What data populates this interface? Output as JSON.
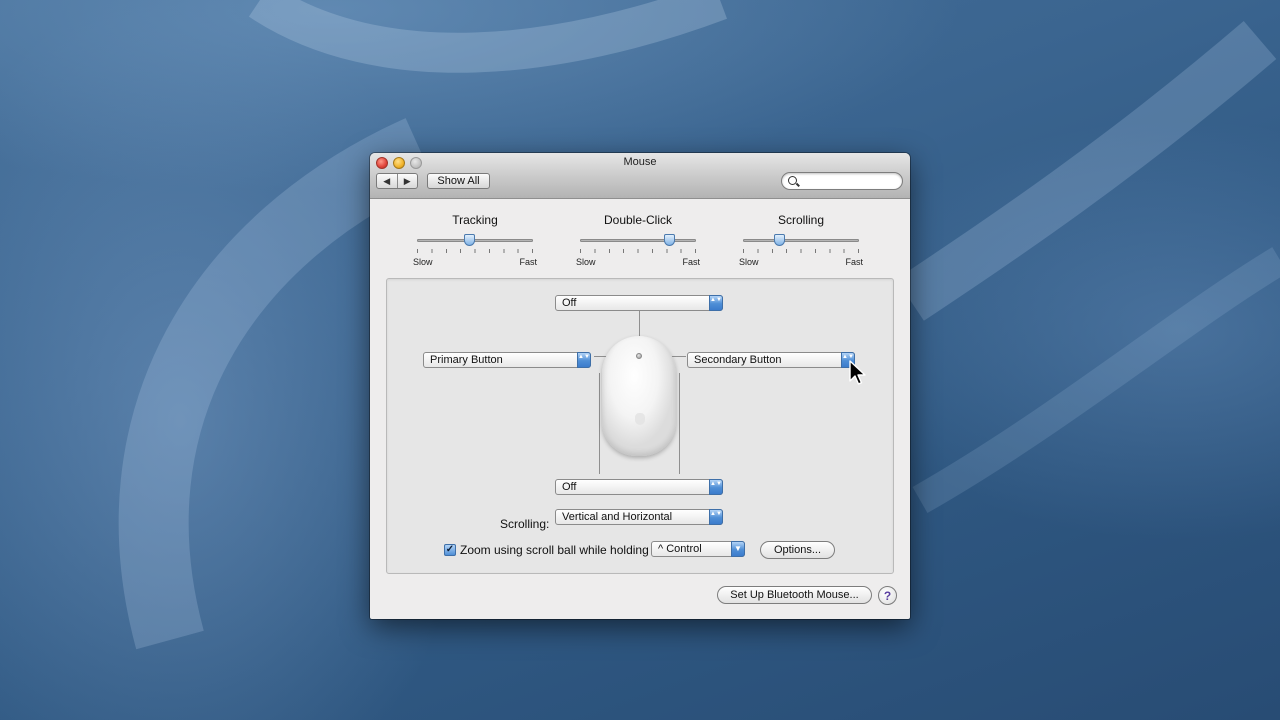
{
  "window": {
    "title": "Mouse"
  },
  "toolbar": {
    "back_glyph": "◀",
    "forward_glyph": "▶",
    "show_all_label": "Show All",
    "search_placeholder": ""
  },
  "sliders": [
    {
      "label": "Tracking",
      "min_label": "Slow",
      "max_label": "Fast",
      "value_fraction": 0.45
    },
    {
      "label": "Double-Click",
      "min_label": "Slow",
      "max_label": "Fast",
      "value_fraction": 0.77
    },
    {
      "label": "Scrolling",
      "min_label": "Slow",
      "max_label": "Fast",
      "value_fraction": 0.31
    }
  ],
  "button_mapping": {
    "top": "Off",
    "left": "Primary Button",
    "right": "Secondary Button",
    "bottom": "Off"
  },
  "scrolling": {
    "label": "Scrolling:",
    "value": "Vertical and Horizontal"
  },
  "zoom": {
    "checked": true,
    "check_glyph": "✓",
    "label": "Zoom using scroll ball while holding",
    "modifier": "^ Control",
    "options_label": "Options..."
  },
  "footer": {
    "bluetooth_label": "Set Up Bluetooth Mouse...",
    "help_label": "?"
  },
  "icons": {
    "popup_arrows": "▲▼",
    "popup_down": "▼"
  },
  "colors": {
    "accent": "#4e8ed6",
    "desktop": "#3b6590"
  }
}
